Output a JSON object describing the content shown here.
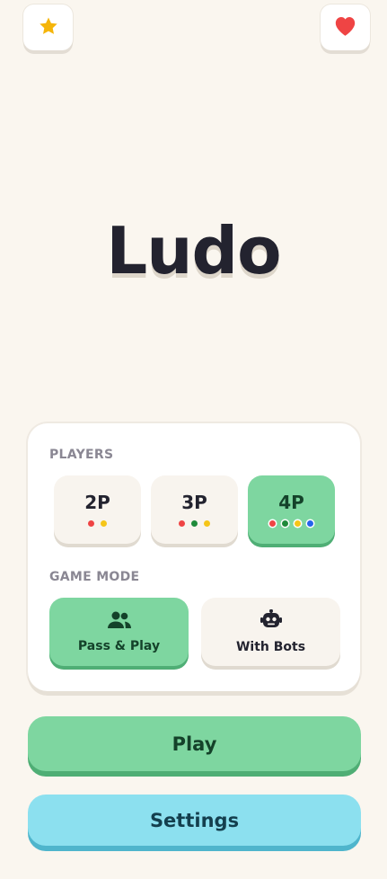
{
  "header": {
    "left_icon": "star-icon",
    "right_icon": "heart-icon",
    "star_color": "#f5b50a",
    "heart_color": "#ef4444"
  },
  "title": "Ludo",
  "setup": {
    "players_label": "PLAYERS",
    "players_options": [
      {
        "label": "2P",
        "colors": [
          "#ef4444",
          "#f5c518"
        ],
        "selected": false
      },
      {
        "label": "3P",
        "colors": [
          "#ef4444",
          "#1e8a3a",
          "#f5c518"
        ],
        "selected": false
      },
      {
        "label": "4P",
        "colors": [
          "#ef4444",
          "#1e8a3a",
          "#f5c518",
          "#2563eb"
        ],
        "selected": true
      }
    ],
    "mode_label": "GAME MODE",
    "mode_options": [
      {
        "label": "Pass & Play",
        "icon": "people-icon",
        "selected": true
      },
      {
        "label": "With Bots",
        "icon": "robot-icon",
        "selected": false
      }
    ]
  },
  "actions": {
    "play_label": "Play",
    "settings_label": "Settings"
  },
  "colors": {
    "accent_green": "#7ed6a0",
    "accent_cyan": "#8ce0ef",
    "background": "#faf6ef"
  }
}
